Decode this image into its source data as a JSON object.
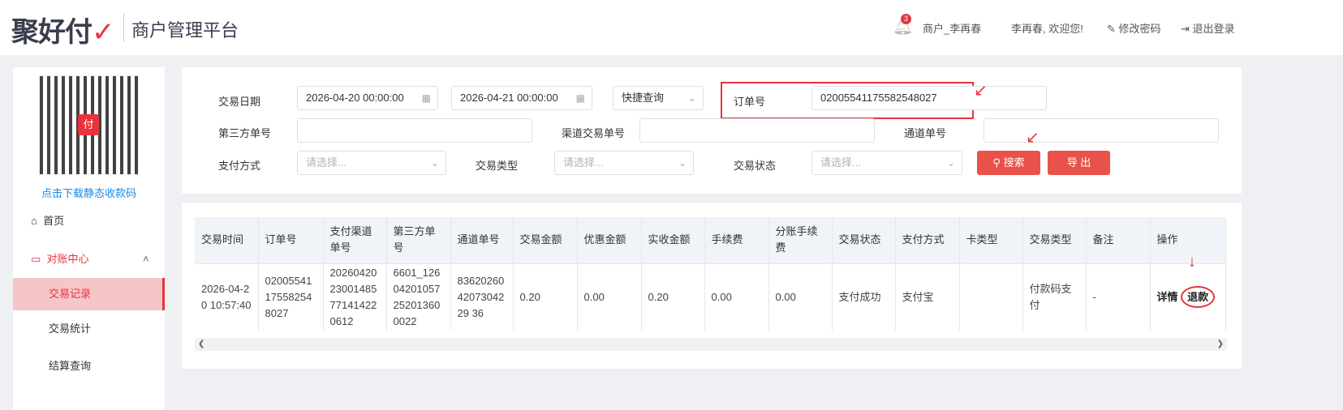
{
  "header": {
    "logo": "聚好付",
    "subtitle": "商户管理平台",
    "notifications": "3",
    "merchant": "商户_李再春",
    "welcome": "李再春, 欢迎您!",
    "change_password": "修改密码",
    "logout": "退出登录"
  },
  "sidebar": {
    "qr_link": "点击下载静态收款码",
    "items": [
      {
        "label": "首页"
      },
      {
        "label": "对账中心"
      },
      {
        "label": "交易记录"
      },
      {
        "label": "交易统计"
      },
      {
        "label": "结算查询"
      }
    ]
  },
  "filter": {
    "date_label": "交易日期",
    "date_start": "2026-04-20 00:00:00",
    "date_end": "2026-04-21 00:00:00",
    "quick": "快捷查询",
    "order_label": "订单号",
    "order_value": "02005541175582548027",
    "third_label": "第三方单号",
    "channel_trade_label": "渠道交易单号",
    "channel_no_label": "通道单号",
    "pay_method_label": "支付方式",
    "trade_type_label": "交易类型",
    "trade_status_label": "交易状态",
    "placeholder": "请选择...",
    "search": "搜索",
    "export": "导 出"
  },
  "table": {
    "headers": [
      "交易时间",
      "订单号",
      "支付渠道单号",
      "第三方单号",
      "通道单号",
      "交易金额",
      "优惠金额",
      "实收金额",
      "手续费",
      "分账手续费",
      "交易状态",
      "支付方式",
      "卡类型",
      "交易类型",
      "备注",
      "操作"
    ],
    "rows": [
      {
        "cells": [
          "2026-04-20 10:57:40",
          "02005541175582548027",
          "202604202300148577141422 0612",
          "6601_12604201057252013600022",
          "836202604207304229 36",
          "0.20",
          "0.00",
          "0.20",
          "0.00",
          "0.00",
          "支付成功",
          "支付宝",
          "",
          "付款码支付",
          "-"
        ],
        "detail": "详情",
        "refund": "退款"
      }
    ]
  },
  "colors": {
    "accent": "#e8333d",
    "button": "#e8524a"
  }
}
